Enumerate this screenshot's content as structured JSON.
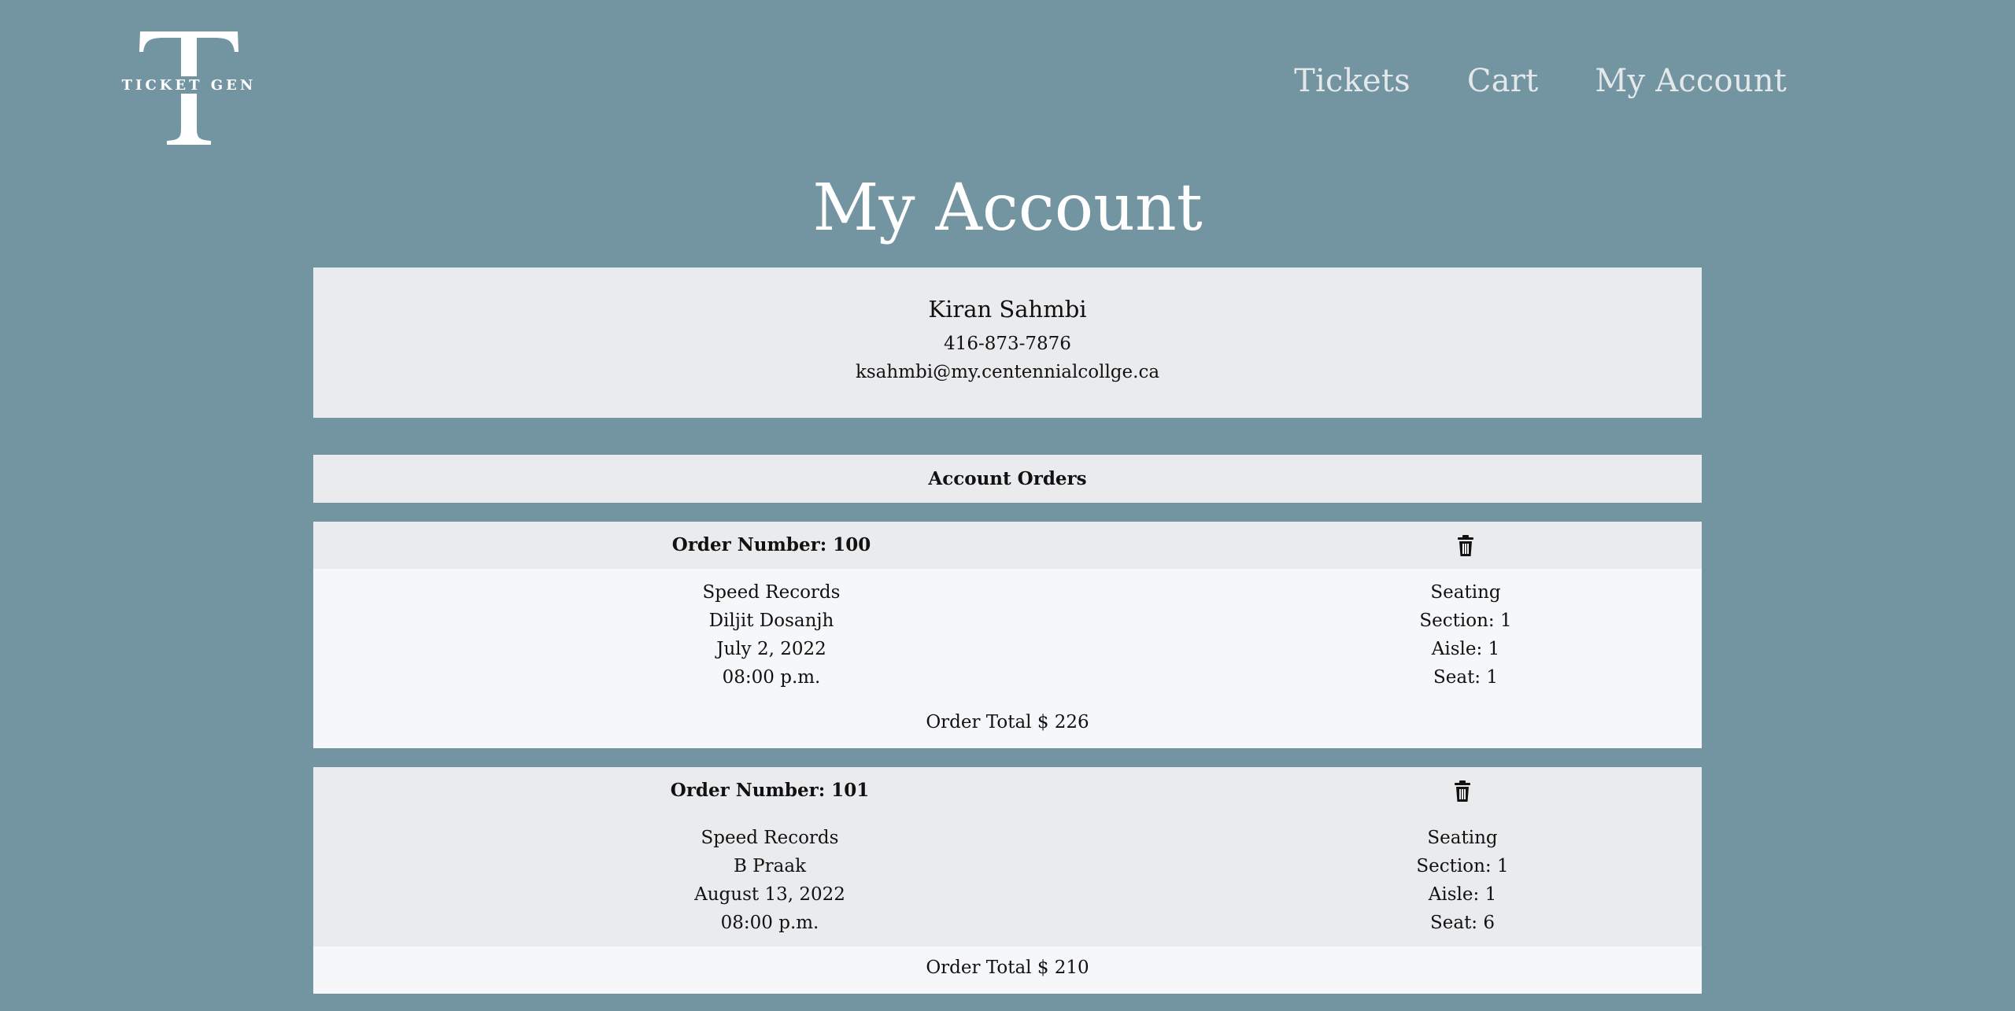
{
  "brand": {
    "logo_text": "TICKET GEN",
    "logo_letter": "T"
  },
  "nav": {
    "items": [
      "Tickets",
      "Cart",
      "My Account"
    ]
  },
  "page": {
    "title": "My Account"
  },
  "profile": {
    "name": "Kiran Sahmbi",
    "phone": "416-873-7876",
    "email": "ksahmbi@my.centennialcollge.ca"
  },
  "orders_section": {
    "title": "Account Orders"
  },
  "orders": [
    {
      "order_number_label": "Order Number: 100",
      "venue": "Speed Records",
      "artist": "Diljit Dosanjh",
      "date": "July 2, 2022",
      "time": "08:00 p.m.",
      "seating_label": "Seating",
      "section": "Section: 1",
      "aisle": "Aisle: 1",
      "seat": "Seat: 1",
      "total": "Order Total $ 226"
    },
    {
      "order_number_label": "Order Number: 101",
      "venue": "Speed Records",
      "artist": "B Praak",
      "date": "August 13, 2022",
      "time": "08:00 p.m.",
      "seating_label": "Seating",
      "section": "Section: 1",
      "aisle": "Aisle: 1",
      "seat": "Seat: 6",
      "total": "Order Total $ 210"
    }
  ],
  "colors": {
    "background": "#7295a1",
    "panel": "#eaebed",
    "panel_light": "#f6f7f9",
    "nav_text": "#e4e8ea",
    "title_text": "#ffffff"
  },
  "icons": {
    "delete": "trash-icon"
  }
}
